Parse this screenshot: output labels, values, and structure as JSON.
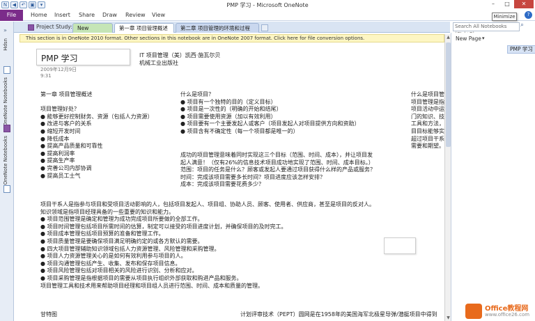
{
  "window": {
    "title": "PMP 学习 - Microsoft OneNote",
    "tooltip": "Minimize",
    "minimize": "–",
    "maximize": "□",
    "close": "✕"
  },
  "ribbon": {
    "file": "File",
    "tabs": [
      "Home",
      "Insert",
      "Share",
      "Draw",
      "Review",
      "View"
    ]
  },
  "leftnav": {
    "notebooks": [
      "Hdsn",
      "OneNote Notebooks",
      "OneNote Notebooks"
    ]
  },
  "sectionbar": {
    "notebook": "Project Study:",
    "tabs": [
      "New Section 2",
      "第一章 项目管理概述",
      "第二章 项目管理的环境和过程"
    ]
  },
  "search": {
    "placeholder": "Search All Notebooks (Ctrl+E)"
  },
  "infobar": {
    "text": "This section is in OneNote 2010 format. Other sections in this notebook are in OneNote 2007 format. Click here for file conversion options."
  },
  "page": {
    "title": "PMP 学习",
    "date": "2009年12月9日",
    "time": "9:31",
    "book_line1": "IT 项目管理（美）凯西·施瓦尔贝",
    "book_line2": "机械工业出版社",
    "col1": {
      "heading": "第一章 项目管理概述",
      "subheading": "项目管理好处？",
      "items": [
        "● 能够更好控制财务、资源（包括人力资源）",
        "● 改进与客户的关系",
        "● 缩短开发时间",
        "● 降低成本",
        "● 提高产品质量和可靠性",
        "● 提高利润率",
        "● 提高生产率",
        "● 完善公司内部协调",
        "● 提高员工士气"
      ]
    },
    "col2": {
      "heading": "什么是项目？",
      "items": [
        "● 项目有一个独特的目的（定义目标）",
        "● 项目是一次性的（明确的开始和结尾）",
        "● 项目需要使用资源（加以有效利用）",
        "● 项目要有一个主要发起人或客户（项目发起人对项目提供方向和资助）",
        "● 项目含有不确定性（每一个项目都是唯一的）"
      ]
    },
    "col2b": {
      "lines": [
        "成功的项目管理意味着同时实现这三个目标（范围、时间、成本），并让项目发",
        "起人满意！（仅有26%的信息技术项目成功地实现了范围、时间、成本目标。）",
        "范围：项目的任务是什么？顾客或发起人要通过项目获得什么样的产品或服务？",
        "时间：完成该项目需要多长时间？项目进度应该怎样安排？",
        "成本：完成该项目需要花费多少？"
      ]
    },
    "col3": {
      "lines": [
        "什么是项目管理？",
        "项目管理是指“在",
        "项目活动中运用专",
        "门的知识、技能、",
        "工具和方法，使项",
        "目目标能够实现或",
        "超过项目干系人的",
        "需要和期望。"
      ]
    },
    "para": {
      "lines": [
        "项目干系人是指参与项目和受项目活动影响的人，包括项目发起人、项目组、协助人员、顾客、使用者、供应商，甚至是项目的反对人。",
        "知识领域是指项目经理具备的一些重要的知识和能力。",
        "● 项目范围管理是确定和管理为成功完成项目所要做的全部工作。",
        "● 项目时间管理包括项目所需时间的估算，制定可以接受的项目进度计划，并确保项目的及时完工。",
        "● 项目成本管理包括项目预算的准备和管理工作。",
        "● 项目质量管理是要确保项目满足明确约定的或各方默认的需要。",
        "● 四大项目管理辅助知识领域包括人力资源管理、风险管理和采购管理。",
        "● 项目人力资源管理关心的是如何有效利用参与项目的人。",
        "● 项目沟通管理包括产生、收集、发布和保存项目信息。",
        "● 项目风险管理包括对项目相关的风险进行识别、分析和应对。",
        "● 项目采购管理是指根据项目的需要从项目执行组织外部获取和购进产品和服务。",
        "项目管理工具和技术用来帮助项目经理和项目组人员进行范围、时间、成本和质量的管理。"
      ]
    },
    "bottom1": "甘特图",
    "bottom2": "计划评审技术（PEPT）圆网是在1958年的美国海军北极星导弹/潜艇项目中得到"
  },
  "pagelist": {
    "new_page": "New Page",
    "new_page_icon": "▾",
    "items": [
      "PMP 学习"
    ]
  },
  "ime": {
    "items": [
      "S",
      "中",
      "ﾟ",
      "☺",
      "⌨",
      "✱"
    ]
  },
  "watermark": {
    "line1": "Office教程网",
    "line2": "www.office26.com"
  }
}
